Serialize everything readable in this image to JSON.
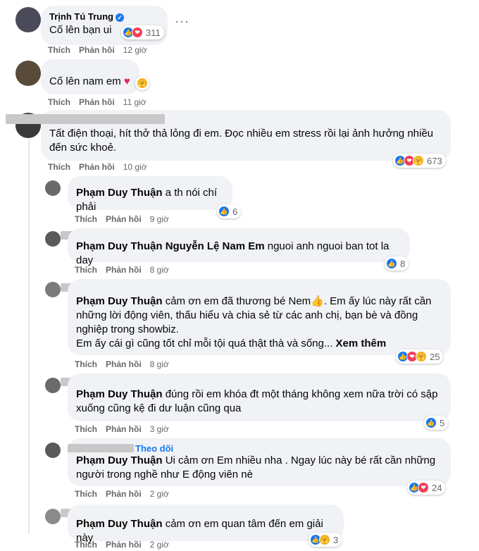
{
  "comments": [
    {
      "author": "Trịnh Tú Trung",
      "text": "Cố lên bạn ui",
      "like": "Thích",
      "reply": "Phản hồi",
      "time": "12 giờ",
      "reactions": "311"
    },
    {
      "text": "Cố lên nam em",
      "emoji": "❤️",
      "like": "Thích",
      "reply": "Phản hồi",
      "time": "11 giờ"
    },
    {
      "text": "Tất điện thoại, hít thở thả lỏng đi em. Đọc nhiều em stress rồi lại ảnh hưởng nhiều đến sức khoẻ.",
      "like": "Thích",
      "reply": "Phản hồi",
      "time": "10 giờ",
      "reactions": "673"
    }
  ],
  "replies": [
    {
      "mention": "Phạm Duy Thuận",
      "text": "a th nói chí phải",
      "like": "Thích",
      "reply": "Phản hồi",
      "time": "9 giờ",
      "reactions": "6"
    },
    {
      "mention": "Phạm Duy Thuận",
      "mention2": "Nguyễn Lệ Nam Em",
      "text": "nguoi anh nguoi ban tot la day",
      "like": "Thích",
      "reply": "Phản hồi",
      "time": "8 giờ",
      "reactions": "8"
    },
    {
      "mention": "Phạm Duy Thuận",
      "text": "cảm ơn em đã thương bé Nem👍. Em ấy lúc này rất cần những lời động viên, thấu hiểu và chia sẻ từ các anh chị, bạn bè và đồng nghiệp trong showbiz.",
      "text2": "Em ấy cái gì cũng tốt chỉ mỗi tội quá thật thà và sống...",
      "more": "Xem thêm",
      "like": "Thích",
      "reply": "Phản hồi",
      "time": "8 giờ",
      "reactions": "25"
    },
    {
      "mention": "Phạm Duy Thuận",
      "text": "đúng rồi em khóa đt một tháng không xem nữa trời có sập xuống cũng kệ đi dư luận cũng qua",
      "like": "Thích",
      "reply": "Phản hồi",
      "time": "3 giờ",
      "reactions": "5"
    },
    {
      "follow": "Theo dõi",
      "mention": "Phạm Duy Thuận",
      "text": "Ui cảm ơn Em nhiều nha . Ngay lúc này bé rất cần những người trong nghề như E động viên nè",
      "like": "Thích",
      "reply": "Phản hồi",
      "time": "2 giờ",
      "reactions": "24"
    },
    {
      "mention": "Phạm Duy Thuận",
      "text": "cảm ơn em quan tâm đến em giải này",
      "like": "Thích",
      "reply": "Phản hồi",
      "time": "2 giờ",
      "reactions": "3"
    }
  ],
  "icons": {
    "options": "…",
    "verified": "check",
    "like": "👍",
    "love": "❤",
    "care": "🤗"
  }
}
